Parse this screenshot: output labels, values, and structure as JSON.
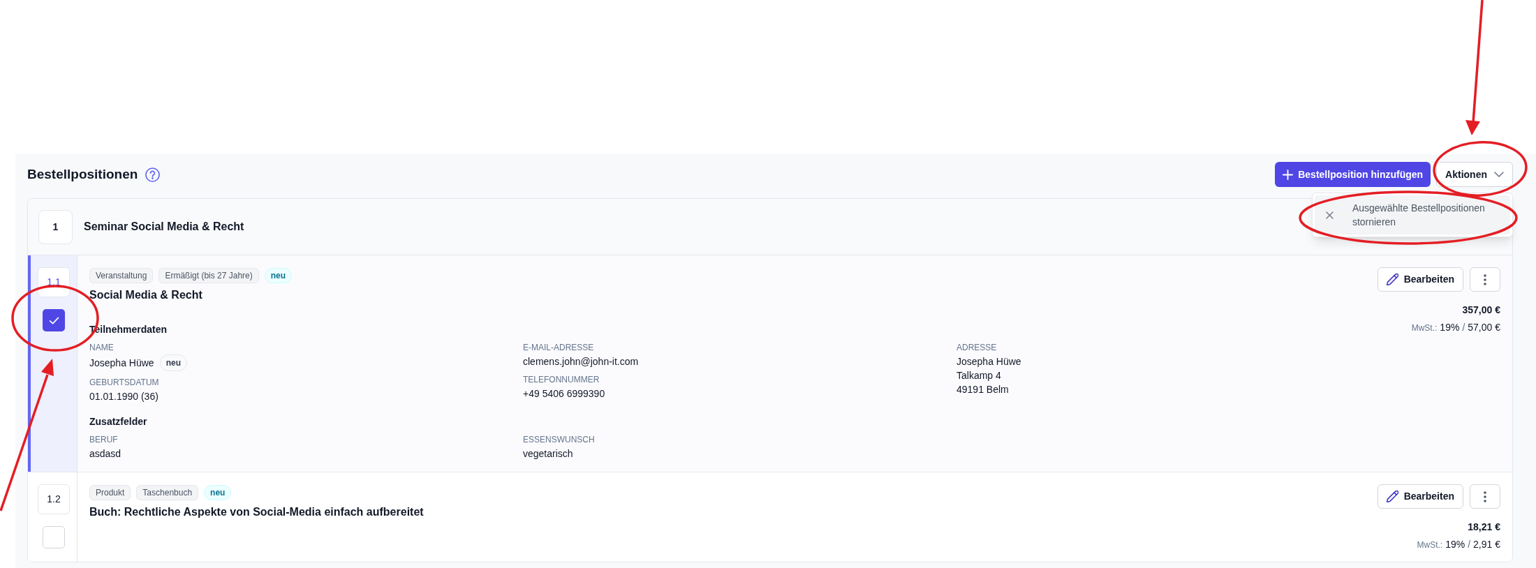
{
  "section": {
    "title": "Bestellpositionen",
    "add_button": "Bestellposition hinzufügen",
    "actions_button": "Aktionen",
    "actions_menu": [
      {
        "label": "Ausgewählte Bestellpositionen stornieren",
        "highlighted": true
      }
    ]
  },
  "groups": [
    {
      "number": "1",
      "title": "Seminar Social Media & Recht",
      "items": [
        {
          "number": "1.1",
          "checked": true,
          "tags": [
            {
              "label": "Veranstaltung",
              "kind": "category"
            },
            {
              "label": "Ermäßigt (bis 27 Jahre)",
              "kind": "category"
            },
            {
              "label": "neu",
              "kind": "new"
            }
          ],
          "title": "Social Media & Recht",
          "edit_button": "Bearbeiten",
          "price": "357,00 €",
          "vat": {
            "label": "MwSt.:",
            "rate": "19%",
            "separator": "/",
            "amount": "57,00 €"
          },
          "sections": [
            {
              "heading": "Teilnehmerdaten",
              "columns": [
                [
                  {
                    "label": "NAME",
                    "lines": [
                      "Josepha Hüwe"
                    ],
                    "badge": "neu"
                  },
                  {
                    "label": "GEBURTSDATUM",
                    "lines": [
                      "01.01.1990 (36)"
                    ]
                  }
                ],
                [
                  {
                    "label": "E-MAIL-ADRESSE",
                    "lines": [
                      "clemens.john@john-it.com"
                    ]
                  },
                  {
                    "label": "TELEFONNUMMER",
                    "lines": [
                      "+49 5406 6999390"
                    ]
                  }
                ],
                [
                  {
                    "label": "ADRESSE",
                    "lines": [
                      "Josepha Hüwe",
                      "Talkamp 4",
                      "49191 Belm"
                    ]
                  }
                ]
              ]
            },
            {
              "heading": "Zusatzfelder",
              "columns": [
                [
                  {
                    "label": "BERUF",
                    "lines": [
                      "asdasd"
                    ]
                  }
                ],
                [
                  {
                    "label": "ESSENSWUNSCH",
                    "lines": [
                      "vegetarisch"
                    ]
                  }
                ]
              ]
            }
          ]
        },
        {
          "number": "1.2",
          "checked": false,
          "tags": [
            {
              "label": "Produkt",
              "kind": "category"
            },
            {
              "label": "Taschenbuch",
              "kind": "category"
            },
            {
              "label": "neu",
              "kind": "new"
            }
          ],
          "title": "Buch: Rechtliche Aspekte von Social-Media einfach aufbereitet",
          "edit_button": "Bearbeiten",
          "price": "18,21 €",
          "vat": {
            "label": "MwSt.:",
            "rate": "19%",
            "separator": "/",
            "amount": "2,91 €"
          }
        }
      ]
    }
  ]
}
